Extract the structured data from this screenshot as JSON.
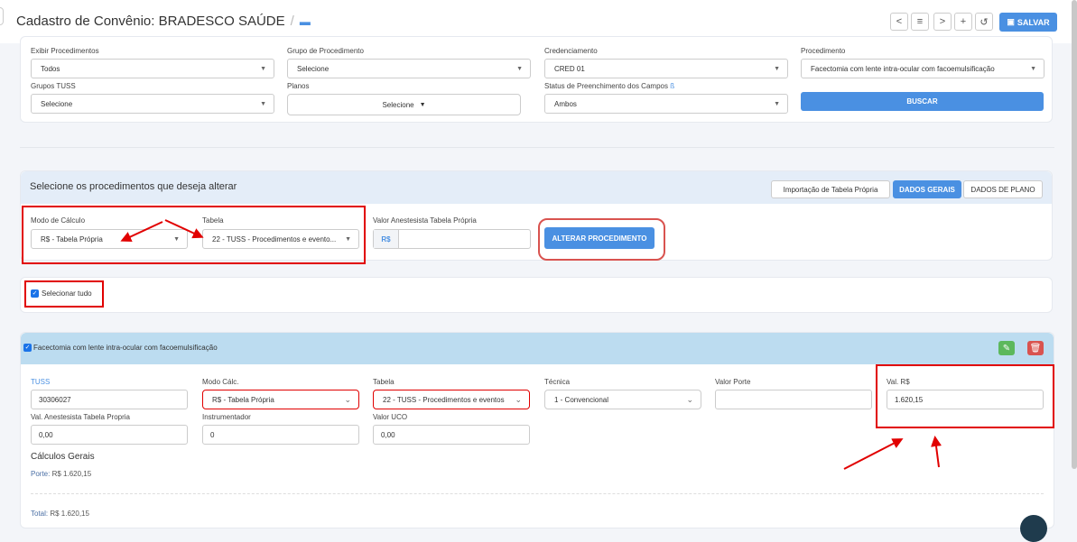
{
  "header": {
    "title": "Cadastro de Convênio: BRADESCO SAÚDE",
    "save_label": "SALVAR",
    "toolbar": {
      "prev": "<",
      "list": "≡",
      "next": ">",
      "add": "+",
      "history": "↺"
    }
  },
  "filters": {
    "exibir": {
      "label": "Exibir Procedimentos",
      "value": "Todos"
    },
    "grupo": {
      "label": "Grupo de Procedimento",
      "value": "Selecione"
    },
    "credenciamento": {
      "label": "Credenciamento",
      "value": "CRED 01"
    },
    "procedimento": {
      "label": "Procedimento",
      "value": "Facectomia com lente intra-ocular com facoemulsificação"
    },
    "grupos_tuss": {
      "label": "Grupos TUSS",
      "value": "Selecione"
    },
    "planos": {
      "label": "Planos",
      "value": "Selecione"
    },
    "status": {
      "label": "Status de Preenchimento dos Campos",
      "value": "Ambos"
    },
    "buscar": "BUSCAR"
  },
  "alter": {
    "title": "Selecione os procedimentos que deseja alterar",
    "tabs": [
      "Importação de Tabela Própria",
      "DADOS GERAIS",
      "DADOS DE PLANO"
    ],
    "modo_label": "Modo de Cálculo",
    "modo_value": "R$ - Tabela Própria",
    "tabela_label": "Tabela",
    "tabela_value": "22 - TUSS - Procedimentos e evento...",
    "anest_label": "Valor Anestesista Tabela Própria",
    "currency": "R$",
    "alterar_btn": "ALTERAR PROCEDIMENTO"
  },
  "select_all": "Selecionar tudo",
  "proc": {
    "name": "Facectomia com lente intra-ocular com facoemulsificação",
    "tuss_label": "TUSS",
    "tuss_value": "30306027",
    "modo_label": "Modo Cálc.",
    "modo_value": "R$ - Tabela Própria",
    "tabela_label": "Tabela",
    "tabela_value": "22 - TUSS - Procedimentos e eventos",
    "tecnica_label": "Técnica",
    "tecnica_value": "1 - Convencional",
    "porte_label": "Valor Porte",
    "porte_value": "",
    "valrs_label": "Val. R$",
    "valrs_value": "1.620,15",
    "anest_label": "Val. Anestesista Tabela Propria",
    "anest_value": "0,00",
    "instr_label": "Instrumentador",
    "instr_value": "0",
    "uco_label": "Valor UCO",
    "uco_value": "0,00",
    "calc_title": "Cálculos Gerais",
    "porte_text_label": "Porte:",
    "porte_text_value": "R$ 1.620,15",
    "total_label": "Total:",
    "total_value": "R$ 1.620,15"
  },
  "colors": {
    "accent": "#4a90e2",
    "highlight": "#e10000",
    "proc_header": "#bcdcf0"
  }
}
